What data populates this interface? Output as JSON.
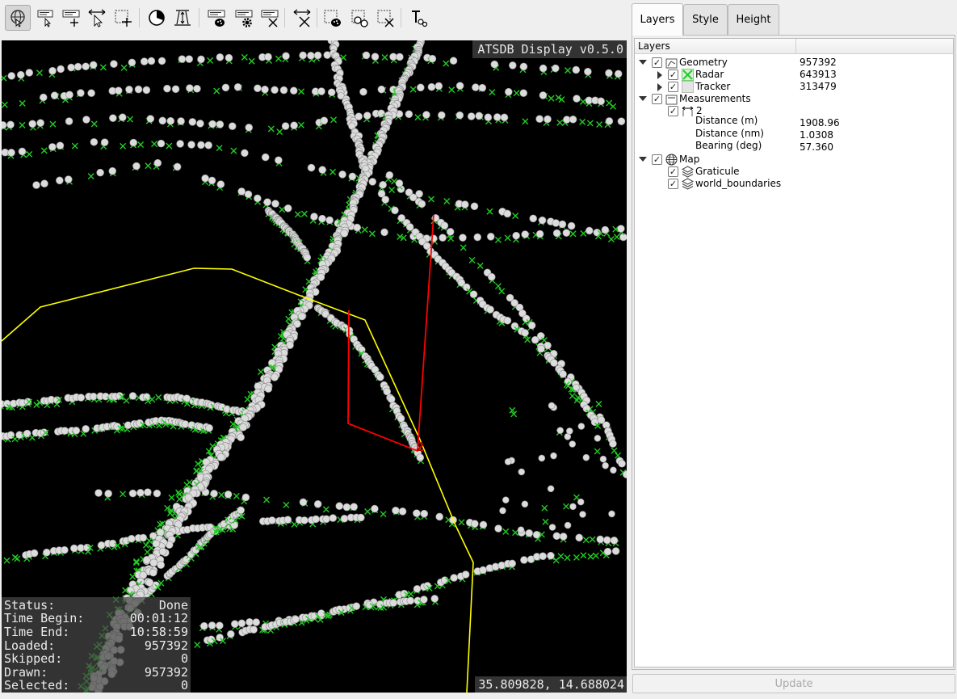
{
  "toolbar": {
    "tools": [
      {
        "icon": "navigate-icon",
        "active": true
      },
      {
        "icon": "label-icon"
      },
      {
        "icon": "add-label-icon"
      },
      {
        "icon": "select-move-icon"
      },
      {
        "icon": "select-rectangle-icon"
      },
      {
        "icon": "timeline-icon"
      },
      {
        "icon": "height-filter-icon"
      },
      {
        "icon": "style-icon"
      },
      {
        "icon": "settings-icon"
      },
      {
        "icon": "clear-icon"
      },
      {
        "icon": "measure-clear-icon"
      },
      {
        "icon": "select-style-icon"
      },
      {
        "icon": "select-compare-icon"
      },
      {
        "icon": "deselect-icon"
      },
      {
        "icon": "text-tool-icon"
      }
    ]
  },
  "map": {
    "title": "ATSDB Display v0.5.0",
    "coordinates": "35.809828, 14.688024",
    "measurement_label": "2",
    "colors": {
      "background": "#000000",
      "radar": "#22cc22",
      "tracker": "#dcdcdc",
      "boundary": "#ffff00",
      "measurement": "#ff0000"
    },
    "status": [
      {
        "label": "Status:",
        "value": "Done"
      },
      {
        "label": "Time Begin:",
        "value": "00:01:12"
      },
      {
        "label": "Time End:",
        "value": "10:58:59"
      },
      {
        "label": "Loaded:",
        "value": "957392"
      },
      {
        "label": "Skipped:",
        "value": "0"
      },
      {
        "label": "Drawn:",
        "value": "957392"
      },
      {
        "label": "Selected:",
        "value": "0"
      }
    ]
  },
  "panel": {
    "tabs": [
      "Layers",
      "Style",
      "Height"
    ],
    "active_tab": "Layers",
    "tree_header": "Layers",
    "tree": {
      "geometry": {
        "label": "Geometry",
        "value": "957392"
      },
      "radar": {
        "label": "Radar",
        "value": "643913"
      },
      "tracker": {
        "label": "Tracker",
        "value": "313479"
      },
      "measurements": {
        "label": "Measurements"
      },
      "measurement2": {
        "label": "2"
      },
      "distance_m": {
        "label": "Distance (m)",
        "value": "1908.96"
      },
      "distance_nm": {
        "label": "Distance (nm)",
        "value": "1.0308"
      },
      "bearing": {
        "label": "Bearing (deg)",
        "value": "57.360"
      },
      "map": {
        "label": "Map"
      },
      "graticule": {
        "label": "Graticule"
      },
      "world_boundaries": {
        "label": "world_boundaries"
      }
    },
    "update_label": "Update"
  }
}
